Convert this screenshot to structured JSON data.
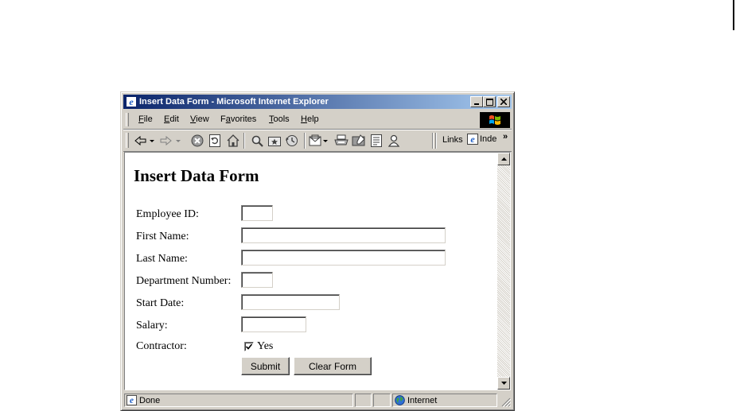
{
  "window": {
    "title": "Insert Data Form - Microsoft Internet Explorer",
    "buttons": {
      "minimize": "_",
      "maximize": "□",
      "close": "×"
    }
  },
  "menu": {
    "items": [
      {
        "label": "File",
        "accel": "F",
        "rest": "ile"
      },
      {
        "label": "Edit",
        "accel": "E",
        "rest": "dit"
      },
      {
        "label": "View",
        "accel": "V",
        "rest": "iew"
      },
      {
        "label": "Favorites",
        "accel": "a",
        "pre": "F",
        "rest": "vorites"
      },
      {
        "label": "Tools",
        "accel": "T",
        "rest": "ools"
      },
      {
        "label": "Help",
        "accel": "H",
        "rest": "elp"
      }
    ]
  },
  "toolbar": {
    "icons": [
      "back-icon",
      "forward-icon",
      "stop-icon",
      "refresh-icon",
      "home-icon",
      "search-icon",
      "favorites-icon",
      "history-icon",
      "mail-icon",
      "print-icon",
      "edit-icon",
      "discuss-icon",
      "messenger-icon"
    ],
    "links_label": "Links",
    "links_item": "Inde",
    "chevron": "»"
  },
  "form": {
    "heading": "Insert Data Form",
    "fields": {
      "employee_id": {
        "label": "Employee ID:",
        "value": ""
      },
      "first_name": {
        "label": "First Name:",
        "value": ""
      },
      "last_name": {
        "label": "Last Name:",
        "value": ""
      },
      "department_number": {
        "label": "Department Number:",
        "value": ""
      },
      "start_date": {
        "label": "Start Date:",
        "value": ""
      },
      "salary": {
        "label": "Salary:",
        "value": ""
      }
    },
    "contractor": {
      "label": "Contractor:",
      "option": "Yes",
      "checked": true
    },
    "submit_label": "Submit",
    "clear_label": "Clear Form"
  },
  "status": {
    "text": "Done",
    "zone": "Internet"
  },
  "colors": {
    "title_start": "#0a246a",
    "title_end": "#a6caf0",
    "chrome": "#d4d0c8"
  }
}
